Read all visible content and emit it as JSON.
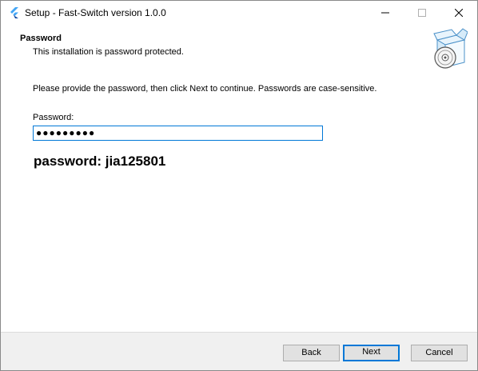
{
  "window": {
    "title": "Setup - Fast-Switch version 1.0.0",
    "controls": {
      "minimize": "minimize-icon",
      "maximize": "maximize-icon",
      "close": "close-icon"
    }
  },
  "header": {
    "title": "Password",
    "subtitle": "This installation is password protected."
  },
  "content": {
    "instruction": "Please provide the password, then click Next to continue. Passwords are case-sensitive.",
    "password_label": "Password:",
    "password_value": "●●●●●●●●●",
    "password_hint": "password: jia125801"
  },
  "buttons": {
    "back": "Back",
    "next": "Next",
    "cancel": "Cancel"
  },
  "colors": {
    "accent": "#0078d7",
    "footer_bg": "#f0f0f0",
    "button_bg": "#e1e1e1"
  }
}
